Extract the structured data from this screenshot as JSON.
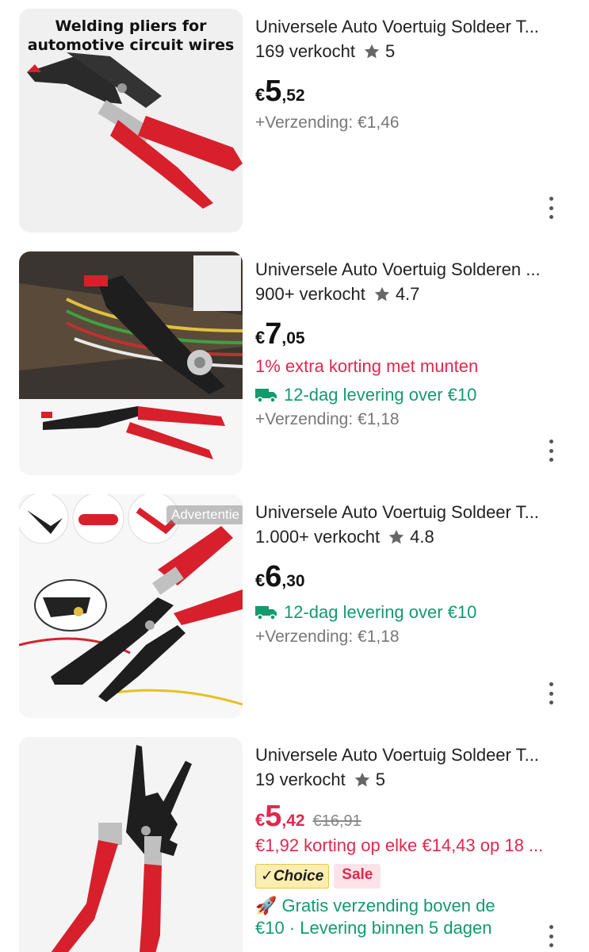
{
  "products": [
    {
      "image_caption_line1": "Welding pliers for",
      "image_caption_line2": "automotive circuit wires",
      "title": "Universele Auto Voertuig Soldeer T...",
      "sold": "169 verkocht",
      "rating": "5",
      "currency": "€",
      "price_int": "5",
      "price_dec": ",52",
      "shipping": "+Verzending: €1,46",
      "icon": "star-icon"
    },
    {
      "title": "Universele Auto Voertuig Solderen ...",
      "sold": "900+ verkocht",
      "rating": "4.7",
      "currency": "€",
      "price_int": "7",
      "price_dec": ",05",
      "promo": "1% extra korting met munten",
      "delivery": "12-dag levering over €10",
      "shipping": "+Verzending: €1,18"
    },
    {
      "ad_label": "Advertentie",
      "title": "Universele Auto Voertuig Soldeer T...",
      "sold": "1.000+ verkocht",
      "rating": "4.8",
      "currency": "€",
      "price_int": "6",
      "price_dec": ",30",
      "delivery": "12-dag levering over €10",
      "shipping": "+Verzending: €1,18"
    },
    {
      "title": "Universele Auto Voertuig Soldeer T...",
      "sold": "19 verkocht",
      "rating": "5",
      "currency": "€",
      "price_int": "5",
      "price_dec": ",42",
      "old_price": "€16,91",
      "promo": "€1,92 korting op elke €14,43 op 18 ...",
      "badge_choice": "Choice",
      "badge_sale": "Sale",
      "free_ship_line1": "Gratis verzending boven de",
      "free_ship_line2": "€10 · Levering binnen 5 dagen"
    }
  ],
  "colors": {
    "price_red": "#e0284d",
    "delivery_green": "#139a6d",
    "handle_red": "#d7202c"
  }
}
